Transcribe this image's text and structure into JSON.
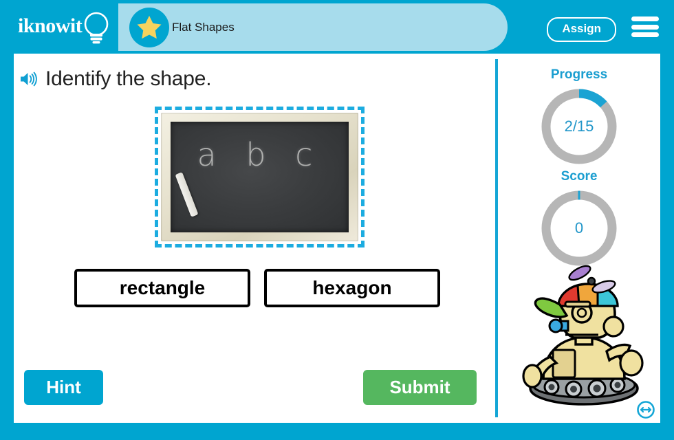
{
  "header": {
    "logo_text": "iknowit",
    "logo_icon": "lightbulb-icon",
    "star_icon": "star-icon",
    "title": "Flat Shapes",
    "assign_label": "Assign",
    "menu_icon": "hamburger-menu-icon"
  },
  "main": {
    "speaker_icon": "speaker-audio-icon",
    "question": "Identify the shape.",
    "image": {
      "name": "chalkboard-image",
      "chalk_text": "a b c",
      "chalk_stick": "chalk-stick"
    },
    "choices": [
      {
        "label": "rectangle"
      },
      {
        "label": "hexagon"
      }
    ],
    "hint_label": "Hint",
    "submit_label": "Submit"
  },
  "sidebar": {
    "progress": {
      "label": "Progress",
      "value": "2/15",
      "current": 2,
      "total": 15,
      "percent": 13.3
    },
    "score": {
      "label": "Score",
      "value": "0",
      "percent": 0
    },
    "mascot": "robot-mascot-icon",
    "resize_icon": "resize-horizontal-icon"
  },
  "colors": {
    "brand_blue": "#00a5d0",
    "pill_blue": "#a7dcec",
    "ring_blue": "#1ba3d3",
    "ring_track": "#b6b6b6",
    "submit_green": "#55b75f",
    "star_gold": "#f5d35e"
  }
}
